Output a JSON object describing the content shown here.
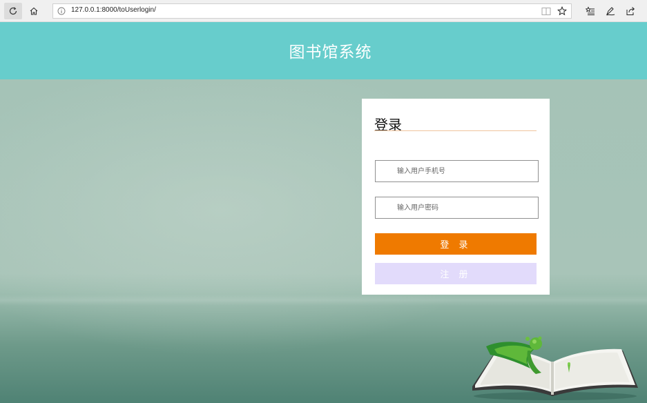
{
  "browser": {
    "url": "127.0.0.1:8000/toUserlogin/",
    "icons": [
      "refresh-icon",
      "home-icon",
      "info-icon",
      "reading-view-icon",
      "favorite-star-icon",
      "favorites-list-icon",
      "pen-icon",
      "share-icon"
    ]
  },
  "header": {
    "title": "图书馆系统"
  },
  "login": {
    "heading": "登录",
    "phone_placeholder": "输入用户手机号",
    "password_placeholder": "输入用户密码",
    "login_label": "登 录",
    "register_label": "注 册"
  },
  "colors": {
    "header_bg": "#67cdcc",
    "login_button": "#ef7a00",
    "register_button": "#e2dbfb",
    "title_underline": "#f0c39c"
  }
}
